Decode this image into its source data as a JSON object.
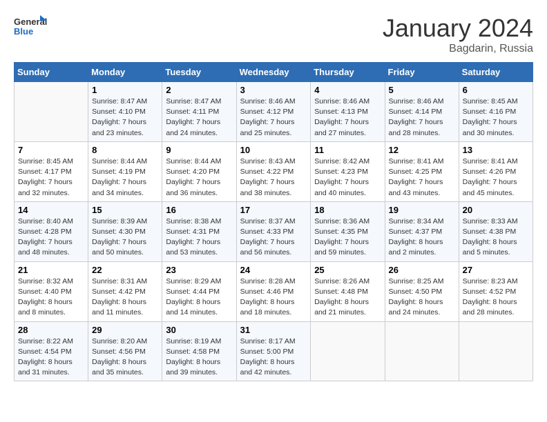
{
  "header": {
    "logo_line1": "General",
    "logo_line2": "Blue",
    "month": "January 2024",
    "location": "Bagdarin, Russia"
  },
  "days_of_week": [
    "Sunday",
    "Monday",
    "Tuesday",
    "Wednesday",
    "Thursday",
    "Friday",
    "Saturday"
  ],
  "weeks": [
    [
      {
        "num": "",
        "info": ""
      },
      {
        "num": "1",
        "info": "Sunrise: 8:47 AM\nSunset: 4:10 PM\nDaylight: 7 hours\nand 23 minutes."
      },
      {
        "num": "2",
        "info": "Sunrise: 8:47 AM\nSunset: 4:11 PM\nDaylight: 7 hours\nand 24 minutes."
      },
      {
        "num": "3",
        "info": "Sunrise: 8:46 AM\nSunset: 4:12 PM\nDaylight: 7 hours\nand 25 minutes."
      },
      {
        "num": "4",
        "info": "Sunrise: 8:46 AM\nSunset: 4:13 PM\nDaylight: 7 hours\nand 27 minutes."
      },
      {
        "num": "5",
        "info": "Sunrise: 8:46 AM\nSunset: 4:14 PM\nDaylight: 7 hours\nand 28 minutes."
      },
      {
        "num": "6",
        "info": "Sunrise: 8:45 AM\nSunset: 4:16 PM\nDaylight: 7 hours\nand 30 minutes."
      }
    ],
    [
      {
        "num": "7",
        "info": "Sunrise: 8:45 AM\nSunset: 4:17 PM\nDaylight: 7 hours\nand 32 minutes."
      },
      {
        "num": "8",
        "info": "Sunrise: 8:44 AM\nSunset: 4:19 PM\nDaylight: 7 hours\nand 34 minutes."
      },
      {
        "num": "9",
        "info": "Sunrise: 8:44 AM\nSunset: 4:20 PM\nDaylight: 7 hours\nand 36 minutes."
      },
      {
        "num": "10",
        "info": "Sunrise: 8:43 AM\nSunset: 4:22 PM\nDaylight: 7 hours\nand 38 minutes."
      },
      {
        "num": "11",
        "info": "Sunrise: 8:42 AM\nSunset: 4:23 PM\nDaylight: 7 hours\nand 40 minutes."
      },
      {
        "num": "12",
        "info": "Sunrise: 8:41 AM\nSunset: 4:25 PM\nDaylight: 7 hours\nand 43 minutes."
      },
      {
        "num": "13",
        "info": "Sunrise: 8:41 AM\nSunset: 4:26 PM\nDaylight: 7 hours\nand 45 minutes."
      }
    ],
    [
      {
        "num": "14",
        "info": "Sunrise: 8:40 AM\nSunset: 4:28 PM\nDaylight: 7 hours\nand 48 minutes."
      },
      {
        "num": "15",
        "info": "Sunrise: 8:39 AM\nSunset: 4:30 PM\nDaylight: 7 hours\nand 50 minutes."
      },
      {
        "num": "16",
        "info": "Sunrise: 8:38 AM\nSunset: 4:31 PM\nDaylight: 7 hours\nand 53 minutes."
      },
      {
        "num": "17",
        "info": "Sunrise: 8:37 AM\nSunset: 4:33 PM\nDaylight: 7 hours\nand 56 minutes."
      },
      {
        "num": "18",
        "info": "Sunrise: 8:36 AM\nSunset: 4:35 PM\nDaylight: 7 hours\nand 59 minutes."
      },
      {
        "num": "19",
        "info": "Sunrise: 8:34 AM\nSunset: 4:37 PM\nDaylight: 8 hours\nand 2 minutes."
      },
      {
        "num": "20",
        "info": "Sunrise: 8:33 AM\nSunset: 4:38 PM\nDaylight: 8 hours\nand 5 minutes."
      }
    ],
    [
      {
        "num": "21",
        "info": "Sunrise: 8:32 AM\nSunset: 4:40 PM\nDaylight: 8 hours\nand 8 minutes."
      },
      {
        "num": "22",
        "info": "Sunrise: 8:31 AM\nSunset: 4:42 PM\nDaylight: 8 hours\nand 11 minutes."
      },
      {
        "num": "23",
        "info": "Sunrise: 8:29 AM\nSunset: 4:44 PM\nDaylight: 8 hours\nand 14 minutes."
      },
      {
        "num": "24",
        "info": "Sunrise: 8:28 AM\nSunset: 4:46 PM\nDaylight: 8 hours\nand 18 minutes."
      },
      {
        "num": "25",
        "info": "Sunrise: 8:26 AM\nSunset: 4:48 PM\nDaylight: 8 hours\nand 21 minutes."
      },
      {
        "num": "26",
        "info": "Sunrise: 8:25 AM\nSunset: 4:50 PM\nDaylight: 8 hours\nand 24 minutes."
      },
      {
        "num": "27",
        "info": "Sunrise: 8:23 AM\nSunset: 4:52 PM\nDaylight: 8 hours\nand 28 minutes."
      }
    ],
    [
      {
        "num": "28",
        "info": "Sunrise: 8:22 AM\nSunset: 4:54 PM\nDaylight: 8 hours\nand 31 minutes."
      },
      {
        "num": "29",
        "info": "Sunrise: 8:20 AM\nSunset: 4:56 PM\nDaylight: 8 hours\nand 35 minutes."
      },
      {
        "num": "30",
        "info": "Sunrise: 8:19 AM\nSunset: 4:58 PM\nDaylight: 8 hours\nand 39 minutes."
      },
      {
        "num": "31",
        "info": "Sunrise: 8:17 AM\nSunset: 5:00 PM\nDaylight: 8 hours\nand 42 minutes."
      },
      {
        "num": "",
        "info": ""
      },
      {
        "num": "",
        "info": ""
      },
      {
        "num": "",
        "info": ""
      }
    ]
  ]
}
